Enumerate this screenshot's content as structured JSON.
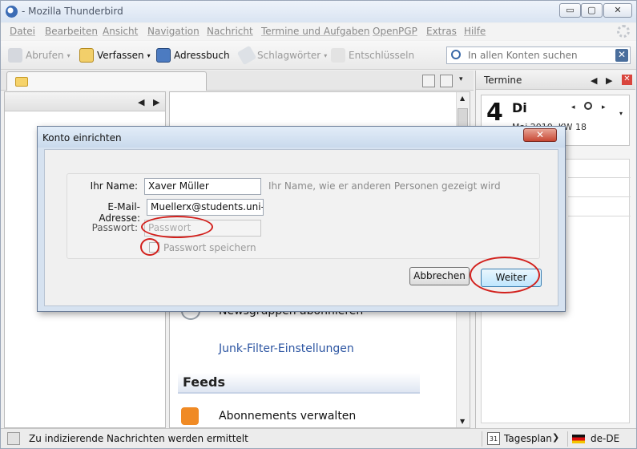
{
  "window": {
    "title": "- Mozilla Thunderbird",
    "minimize": "▭",
    "maximize": "▢",
    "close": "✕"
  },
  "menu": {
    "items": [
      "Datei",
      "Bearbeiten",
      "Ansicht",
      "Navigation",
      "Nachricht",
      "Termine und Aufgaben",
      "OpenPGP",
      "Extras",
      "Hilfe"
    ]
  },
  "toolbar": {
    "get_mail": "Abrufen",
    "write": "Verfassen",
    "address_book": "Adressbuch",
    "tags": "Schlagwörter",
    "decrypt": "Entschlüsseln"
  },
  "search": {
    "placeholder": "In allen Konten suchen",
    "clear": "✕"
  },
  "main": {
    "newsgroups": "Newsgruppen abonnieren",
    "junk": "Junk-Filter-Einstellungen",
    "feeds_heading": "Feeds",
    "subscriptions": "Abonnements verwalten"
  },
  "calendar": {
    "pane_title": "Termine",
    "day_number": "4",
    "weekday": "Di",
    "month_line": "Mai 2010, KW 18"
  },
  "status": {
    "message": "Zu indizierende Nachrichten werden ermittelt",
    "view": "Tagesplan",
    "locale": "de-DE"
  },
  "dialog": {
    "title": "Konto einrichten",
    "name_label": "Ihr Name:",
    "name_value": "Xaver Müller",
    "name_hint": "Ihr Name, wie er anderen Personen gezeigt wird",
    "email_label": "E-Mail-Adresse:",
    "email_value": "Muellerx@students.uni-m",
    "password_label": "Passwort:",
    "password_placeholder": "Passwort",
    "remember_label": "Passwort speichern",
    "remember_checked": false,
    "cancel_button": "Abbrechen",
    "next_button": "Weiter"
  },
  "colors": {
    "annotation_ring": "#d2201c",
    "primary_button": "#bee6fd"
  }
}
